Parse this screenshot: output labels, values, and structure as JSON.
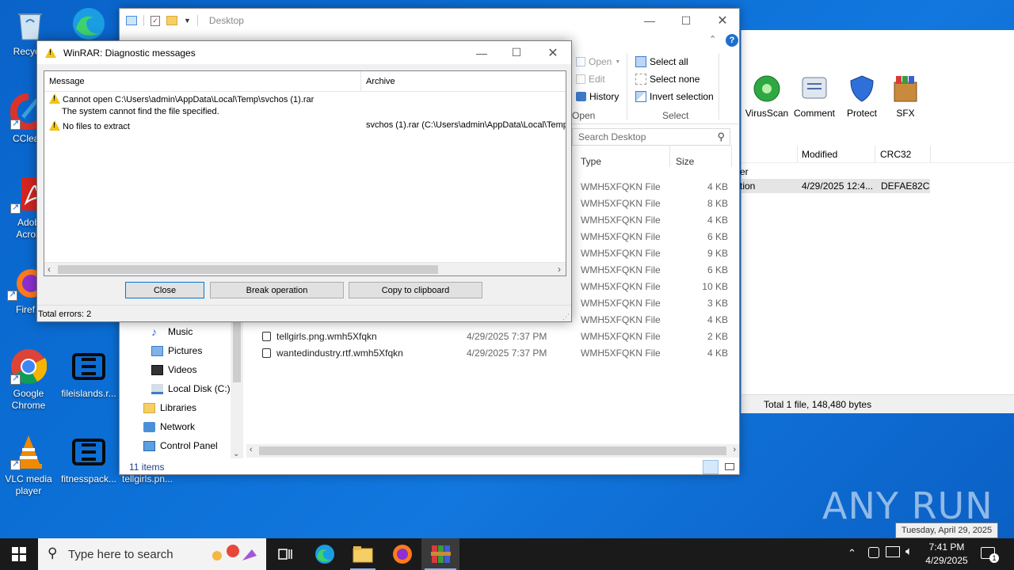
{
  "desktop": {
    "icons": [
      {
        "label": "Recycle"
      },
      {
        "label": "CClean"
      },
      {
        "label": "Adob Acrob"
      },
      {
        "label": "Firef"
      },
      {
        "label": "Google Chrome"
      },
      {
        "label": "fileislands.r..."
      },
      {
        "label": "VLC media player"
      },
      {
        "label": "fitnesspack..."
      },
      {
        "label": "tellgirls.pn..."
      }
    ]
  },
  "explorer": {
    "title": "Desktop",
    "ribbon": {
      "open": "Open",
      "edit": "Edit",
      "history": "History",
      "open_group": "Open",
      "select_all": "Select all",
      "select_none": "Select none",
      "invert_selection": "Invert selection",
      "select_group": "Select"
    },
    "search_placeholder": "Search Desktop",
    "columns": {
      "type": "Type",
      "size": "Size"
    },
    "rows": [
      {
        "name": "",
        "date": "",
        "type": "WMH5XFQKN File",
        "size": "4 KB"
      },
      {
        "name": "",
        "date": "",
        "type": "WMH5XFQKN File",
        "size": "8 KB"
      },
      {
        "name": "",
        "date": "",
        "type": "WMH5XFQKN File",
        "size": "4 KB"
      },
      {
        "name": "",
        "date": "",
        "type": "WMH5XFQKN File",
        "size": "6 KB"
      },
      {
        "name": "",
        "date": "",
        "type": "WMH5XFQKN File",
        "size": "9 KB"
      },
      {
        "name": "",
        "date": "",
        "type": "WMH5XFQKN File",
        "size": "6 KB"
      },
      {
        "name": "",
        "date": "",
        "type": "WMH5XFQKN File",
        "size": "10 KB"
      },
      {
        "name": "",
        "date": "",
        "type": "WMH5XFQKN File",
        "size": "3 KB"
      },
      {
        "name": "",
        "date": "",
        "type": "WMH5XFQKN File",
        "size": "4 KB"
      },
      {
        "name": "tellgirls.png.wmh5Xfqkn",
        "date": "4/29/2025 7:37 PM",
        "type": "WMH5XFQKN File",
        "size": "2 KB"
      },
      {
        "name": "wantedindustry.rtf.wmh5Xfqkn",
        "date": "4/29/2025 7:37 PM",
        "type": "WMH5XFQKN File",
        "size": "4 KB"
      }
    ],
    "nav": [
      {
        "label": "Music"
      },
      {
        "label": "Pictures"
      },
      {
        "label": "Videos"
      },
      {
        "label": "Local Disk (C:)"
      },
      {
        "label": "Libraries"
      },
      {
        "label": "Network"
      },
      {
        "label": "Control Panel"
      }
    ],
    "status": "11 items"
  },
  "winrar_main": {
    "tools": [
      {
        "label": "VirusScan"
      },
      {
        "label": "Comment"
      },
      {
        "label": "Protect"
      },
      {
        "label": "SFX"
      }
    ],
    "columns": {
      "modified": "Modified",
      "crc": "CRC32"
    },
    "partial_1": "er",
    "partial_2": "tion",
    "row_modified": "4/29/2025 12:4...",
    "row_crc": "DEFAE82C",
    "status": "Total 1 file, 148,480 bytes"
  },
  "dialog": {
    "title": "WinRAR: Diagnostic messages",
    "col_message": "Message",
    "col_archive": "Archive",
    "msg1": "Cannot open C:\\Users\\admin\\AppData\\Local\\Temp\\svchos (1).rar",
    "msg1b": "The system cannot find the file specified.",
    "msg2": "No files to extract",
    "msg2_archive": "svchos (1).rar (C:\\Users\\admin\\AppData\\Local\\Temp",
    "btn_close": "Close",
    "btn_break": "Break operation",
    "btn_copy": "Copy to clipboard",
    "status": "Total errors: 2"
  },
  "taskbar": {
    "search_placeholder": "Type here to search",
    "time": "7:41 PM",
    "date": "4/29/2025",
    "tooltip": "Tuesday, April 29, 2025",
    "notification_count": "1"
  },
  "watermark": "ANY RUN"
}
